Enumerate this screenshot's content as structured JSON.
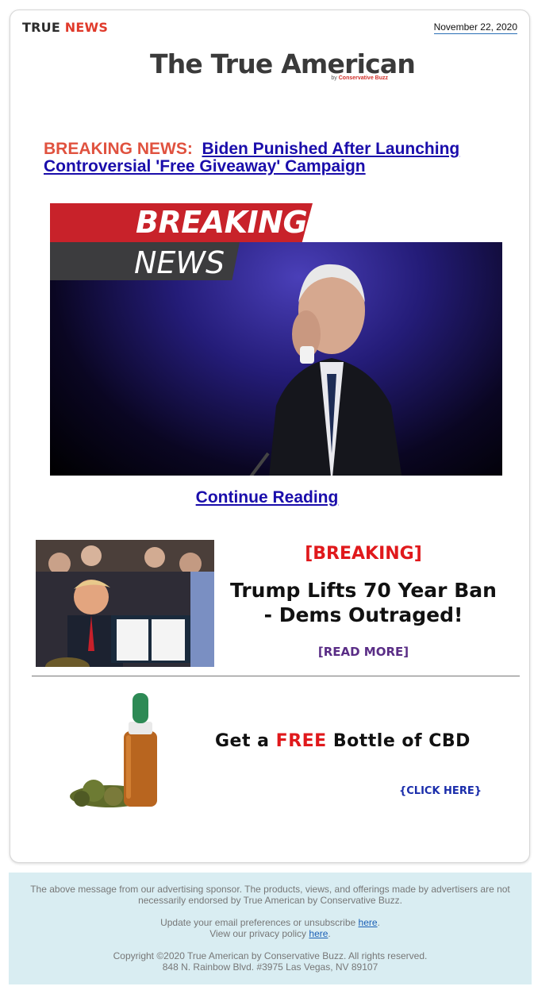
{
  "header": {
    "brand_word1": "TRUE",
    "brand_word2": "NEWS",
    "date": "November 22, 2020",
    "logo_title": "The True American",
    "logo_by": "by",
    "logo_by_brand": "Conservative Buzz"
  },
  "main_story": {
    "lead": "BREAKING NEWS:",
    "headline": "Biden Punished After Launching Controversial 'Free Giveaway' Campaign",
    "banner_top": "BREAKING",
    "banner_bottom": "NEWS",
    "continue_label": "Continue Reading"
  },
  "second_story": {
    "tag": "[BREAKING]",
    "title": "Trump Lifts 70 Year Ban - Dems Outraged!",
    "read_more": "[READ MORE]"
  },
  "ad": {
    "text_prefix": "Get  a",
    "text_highlight": "FREE",
    "text_suffix": "Bottle of CBD",
    "click_label": "{CLICK HERE}"
  },
  "footer": {
    "disclaimer": "The above message from our advertising sponsor. The products, views, and offerings made by advertisers are not necessarily endorsed by True American by Conservative Buzz.",
    "prefs_text": "Update your email preferences or unsubscribe",
    "prefs_link": "here",
    "privacy_text": "View our privacy policy",
    "privacy_link": "here",
    "copyright": "Copyright ©2020 True American by Conservative Buzz. All rights reserved.",
    "address": "848 N. Rainbow Blvd. #3975 Las Vegas, NV 89107"
  },
  "colors": {
    "accent_red": "#e0191c",
    "link_blue": "#1a0dab",
    "footer_bg": "#d9edf2"
  }
}
